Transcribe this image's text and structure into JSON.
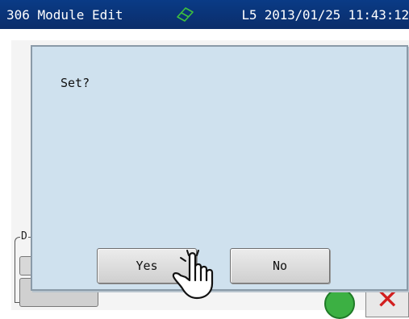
{
  "titlebar": {
    "module_title": "306 Module Edit",
    "status_line": "L5 2013/01/25 11:43:12",
    "icon": "eraser-icon",
    "icon_color": "#3ec03e"
  },
  "background": {
    "group_label": "D"
  },
  "dialog": {
    "message": "Set?",
    "yes_label": "Yes",
    "no_label": "No",
    "background_color": "#cfe1ee"
  },
  "overlay": {
    "pointer_icon": "hand-pointer-icon"
  }
}
